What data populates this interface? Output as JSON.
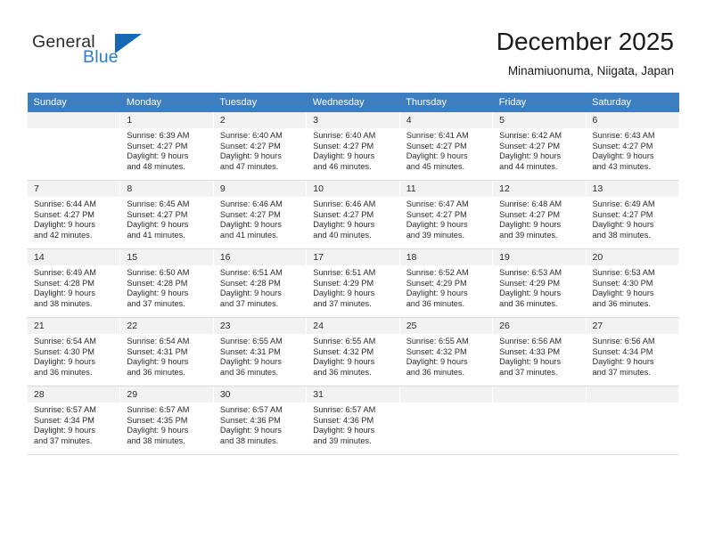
{
  "brand": {
    "name_part1": "General",
    "name_part2": "Blue",
    "flag_icon": "triangle-flag-icon"
  },
  "header": {
    "month_title": "December 2025",
    "location": "Minamiuonuma, Niigata, Japan"
  },
  "calendar": {
    "weekday_headers": [
      "Sunday",
      "Monday",
      "Tuesday",
      "Wednesday",
      "Thursday",
      "Friday",
      "Saturday"
    ],
    "weeks": [
      [
        {
          "day": "",
          "sunrise": "",
          "sunset": "",
          "daylight_line1": "",
          "daylight_line2": ""
        },
        {
          "day": "1",
          "sunrise": "Sunrise: 6:39 AM",
          "sunset": "Sunset: 4:27 PM",
          "daylight_line1": "Daylight: 9 hours",
          "daylight_line2": "and 48 minutes."
        },
        {
          "day": "2",
          "sunrise": "Sunrise: 6:40 AM",
          "sunset": "Sunset: 4:27 PM",
          "daylight_line1": "Daylight: 9 hours",
          "daylight_line2": "and 47 minutes."
        },
        {
          "day": "3",
          "sunrise": "Sunrise: 6:40 AM",
          "sunset": "Sunset: 4:27 PM",
          "daylight_line1": "Daylight: 9 hours",
          "daylight_line2": "and 46 minutes."
        },
        {
          "day": "4",
          "sunrise": "Sunrise: 6:41 AM",
          "sunset": "Sunset: 4:27 PM",
          "daylight_line1": "Daylight: 9 hours",
          "daylight_line2": "and 45 minutes."
        },
        {
          "day": "5",
          "sunrise": "Sunrise: 6:42 AM",
          "sunset": "Sunset: 4:27 PM",
          "daylight_line1": "Daylight: 9 hours",
          "daylight_line2": "and 44 minutes."
        },
        {
          "day": "6",
          "sunrise": "Sunrise: 6:43 AM",
          "sunset": "Sunset: 4:27 PM",
          "daylight_line1": "Daylight: 9 hours",
          "daylight_line2": "and 43 minutes."
        }
      ],
      [
        {
          "day": "7",
          "sunrise": "Sunrise: 6:44 AM",
          "sunset": "Sunset: 4:27 PM",
          "daylight_line1": "Daylight: 9 hours",
          "daylight_line2": "and 42 minutes."
        },
        {
          "day": "8",
          "sunrise": "Sunrise: 6:45 AM",
          "sunset": "Sunset: 4:27 PM",
          "daylight_line1": "Daylight: 9 hours",
          "daylight_line2": "and 41 minutes."
        },
        {
          "day": "9",
          "sunrise": "Sunrise: 6:46 AM",
          "sunset": "Sunset: 4:27 PM",
          "daylight_line1": "Daylight: 9 hours",
          "daylight_line2": "and 41 minutes."
        },
        {
          "day": "10",
          "sunrise": "Sunrise: 6:46 AM",
          "sunset": "Sunset: 4:27 PM",
          "daylight_line1": "Daylight: 9 hours",
          "daylight_line2": "and 40 minutes."
        },
        {
          "day": "11",
          "sunrise": "Sunrise: 6:47 AM",
          "sunset": "Sunset: 4:27 PM",
          "daylight_line1": "Daylight: 9 hours",
          "daylight_line2": "and 39 minutes."
        },
        {
          "day": "12",
          "sunrise": "Sunrise: 6:48 AM",
          "sunset": "Sunset: 4:27 PM",
          "daylight_line1": "Daylight: 9 hours",
          "daylight_line2": "and 39 minutes."
        },
        {
          "day": "13",
          "sunrise": "Sunrise: 6:49 AM",
          "sunset": "Sunset: 4:27 PM",
          "daylight_line1": "Daylight: 9 hours",
          "daylight_line2": "and 38 minutes."
        }
      ],
      [
        {
          "day": "14",
          "sunrise": "Sunrise: 6:49 AM",
          "sunset": "Sunset: 4:28 PM",
          "daylight_line1": "Daylight: 9 hours",
          "daylight_line2": "and 38 minutes."
        },
        {
          "day": "15",
          "sunrise": "Sunrise: 6:50 AM",
          "sunset": "Sunset: 4:28 PM",
          "daylight_line1": "Daylight: 9 hours",
          "daylight_line2": "and 37 minutes."
        },
        {
          "day": "16",
          "sunrise": "Sunrise: 6:51 AM",
          "sunset": "Sunset: 4:28 PM",
          "daylight_line1": "Daylight: 9 hours",
          "daylight_line2": "and 37 minutes."
        },
        {
          "day": "17",
          "sunrise": "Sunrise: 6:51 AM",
          "sunset": "Sunset: 4:29 PM",
          "daylight_line1": "Daylight: 9 hours",
          "daylight_line2": "and 37 minutes."
        },
        {
          "day": "18",
          "sunrise": "Sunrise: 6:52 AM",
          "sunset": "Sunset: 4:29 PM",
          "daylight_line1": "Daylight: 9 hours",
          "daylight_line2": "and 36 minutes."
        },
        {
          "day": "19",
          "sunrise": "Sunrise: 6:53 AM",
          "sunset": "Sunset: 4:29 PM",
          "daylight_line1": "Daylight: 9 hours",
          "daylight_line2": "and 36 minutes."
        },
        {
          "day": "20",
          "sunrise": "Sunrise: 6:53 AM",
          "sunset": "Sunset: 4:30 PM",
          "daylight_line1": "Daylight: 9 hours",
          "daylight_line2": "and 36 minutes."
        }
      ],
      [
        {
          "day": "21",
          "sunrise": "Sunrise: 6:54 AM",
          "sunset": "Sunset: 4:30 PM",
          "daylight_line1": "Daylight: 9 hours",
          "daylight_line2": "and 36 minutes."
        },
        {
          "day": "22",
          "sunrise": "Sunrise: 6:54 AM",
          "sunset": "Sunset: 4:31 PM",
          "daylight_line1": "Daylight: 9 hours",
          "daylight_line2": "and 36 minutes."
        },
        {
          "day": "23",
          "sunrise": "Sunrise: 6:55 AM",
          "sunset": "Sunset: 4:31 PM",
          "daylight_line1": "Daylight: 9 hours",
          "daylight_line2": "and 36 minutes."
        },
        {
          "day": "24",
          "sunrise": "Sunrise: 6:55 AM",
          "sunset": "Sunset: 4:32 PM",
          "daylight_line1": "Daylight: 9 hours",
          "daylight_line2": "and 36 minutes."
        },
        {
          "day": "25",
          "sunrise": "Sunrise: 6:55 AM",
          "sunset": "Sunset: 4:32 PM",
          "daylight_line1": "Daylight: 9 hours",
          "daylight_line2": "and 36 minutes."
        },
        {
          "day": "26",
          "sunrise": "Sunrise: 6:56 AM",
          "sunset": "Sunset: 4:33 PM",
          "daylight_line1": "Daylight: 9 hours",
          "daylight_line2": "and 37 minutes."
        },
        {
          "day": "27",
          "sunrise": "Sunrise: 6:56 AM",
          "sunset": "Sunset: 4:34 PM",
          "daylight_line1": "Daylight: 9 hours",
          "daylight_line2": "and 37 minutes."
        }
      ],
      [
        {
          "day": "28",
          "sunrise": "Sunrise: 6:57 AM",
          "sunset": "Sunset: 4:34 PM",
          "daylight_line1": "Daylight: 9 hours",
          "daylight_line2": "and 37 minutes."
        },
        {
          "day": "29",
          "sunrise": "Sunrise: 6:57 AM",
          "sunset": "Sunset: 4:35 PM",
          "daylight_line1": "Daylight: 9 hours",
          "daylight_line2": "and 38 minutes."
        },
        {
          "day": "30",
          "sunrise": "Sunrise: 6:57 AM",
          "sunset": "Sunset: 4:36 PM",
          "daylight_line1": "Daylight: 9 hours",
          "daylight_line2": "and 38 minutes."
        },
        {
          "day": "31",
          "sunrise": "Sunrise: 6:57 AM",
          "sunset": "Sunset: 4:36 PM",
          "daylight_line1": "Daylight: 9 hours",
          "daylight_line2": "and 39 minutes."
        },
        {
          "day": "",
          "sunrise": "",
          "sunset": "",
          "daylight_line1": "",
          "daylight_line2": ""
        },
        {
          "day": "",
          "sunrise": "",
          "sunset": "",
          "daylight_line1": "",
          "daylight_line2": ""
        },
        {
          "day": "",
          "sunrise": "",
          "sunset": "",
          "daylight_line1": "",
          "daylight_line2": ""
        }
      ]
    ]
  },
  "colors": {
    "header_blue": "#3c7ebf",
    "brand_blue": "#2e7ec4",
    "flag_blue": "#1668b3",
    "daynum_bg": "#f2f2f2",
    "row_divider": "#dcdcdc"
  }
}
